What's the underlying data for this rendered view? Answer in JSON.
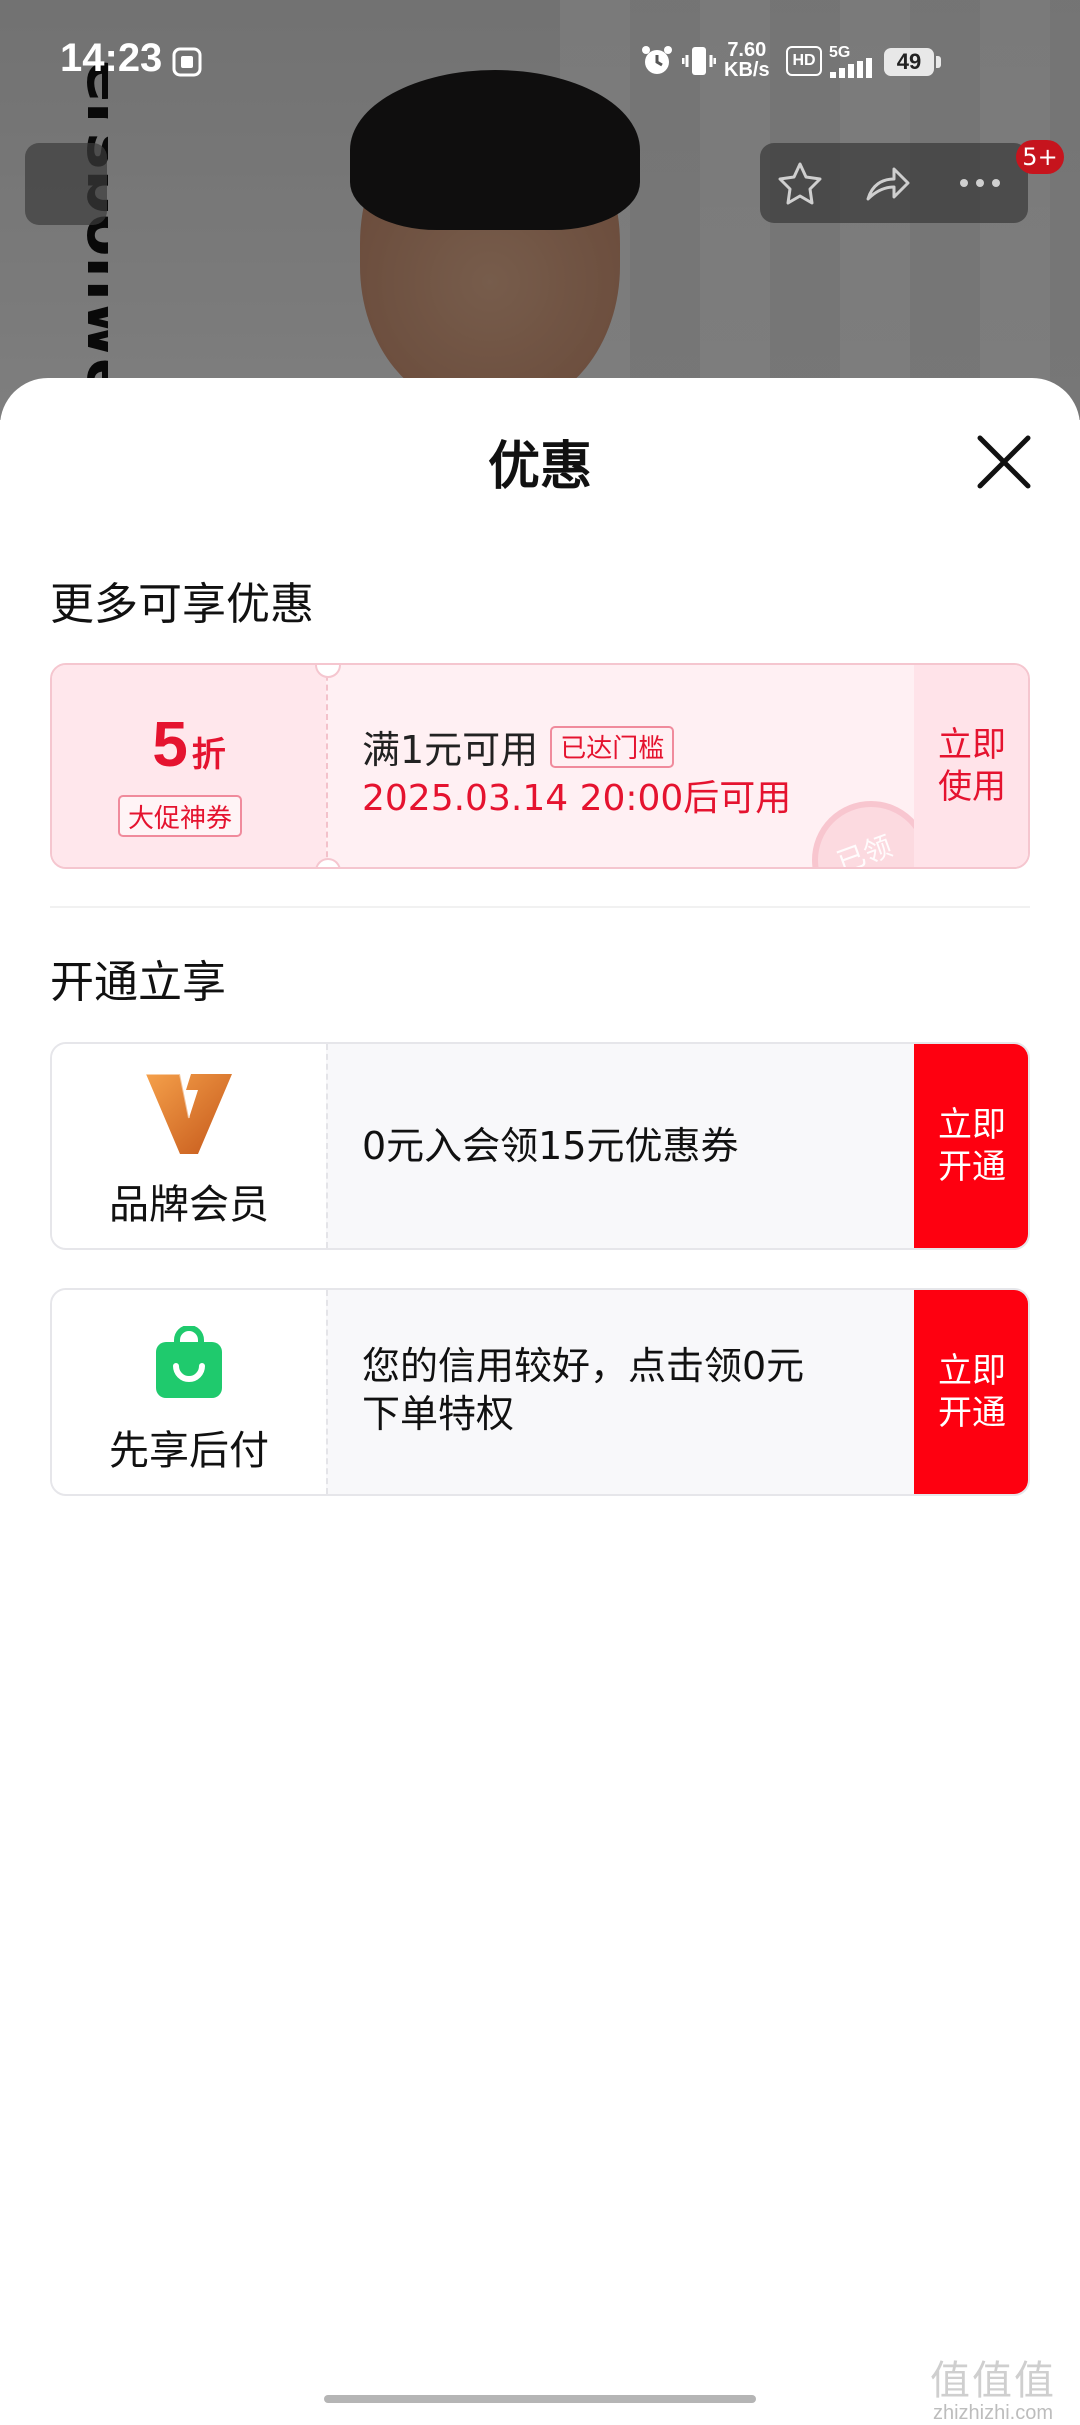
{
  "status_bar": {
    "time": "14:23",
    "net_speed_value": "7.60",
    "net_speed_unit": "KB/s",
    "hd_label": "HD",
    "network_label": "5G",
    "battery": "49"
  },
  "background_page": {
    "brand_text": "ersbonwe",
    "cart_badge": "5+",
    "icons": [
      "back-icon",
      "star-icon",
      "share-icon",
      "more-icon"
    ]
  },
  "sheet": {
    "title": "优惠",
    "close_icon": "close-icon"
  },
  "more_discounts": {
    "section_title": "更多可享优惠",
    "coupon": {
      "discount_value": "5",
      "discount_unit": "折",
      "coupon_type": "大促神券",
      "condition": "满1元可用",
      "threshold_tag": "已达门槛",
      "valid_time": "2025.03.14 20:00后可用",
      "stamp_text": "已领",
      "action_line1": "立即",
      "action_line2": "使用"
    }
  },
  "open_to_enjoy": {
    "section_title": "开通立享",
    "items": [
      {
        "label": "品牌会员",
        "icon": "brand-v-logo-icon",
        "text": "0元入会领15元优惠券",
        "action_line1": "立即",
        "action_line2": "开通"
      },
      {
        "label": "先享后付",
        "icon": "shopping-bag-icon",
        "text_line1": "您的信用较好，点击领0元",
        "text_line2": "下单特权",
        "action_line1": "立即",
        "action_line2": "开通"
      }
    ]
  },
  "watermark": {
    "logo": "值值值",
    "url": "zhizhizhi.com"
  },
  "colors": {
    "accent_red": "#fe0010",
    "coupon_red": "#e5132f",
    "coupon_bg": "#fff0f3",
    "green": "#1fca6d"
  }
}
